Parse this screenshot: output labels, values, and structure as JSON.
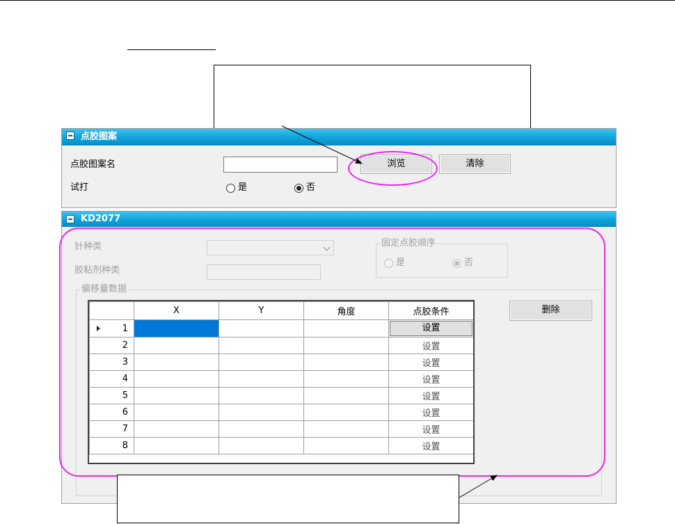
{
  "pattern_panel": {
    "header": "点胶图案",
    "name_label": "点胶图案名",
    "name_value": "",
    "browse_button": "浏览",
    "clear_button": "清除",
    "trial_label": "试打",
    "trial_options": [
      "是",
      "否"
    ],
    "trial_selected": "否"
  },
  "kd_panel": {
    "header": "KD2077",
    "needle_label": "针种类",
    "needle_value": "",
    "adhesive_label": "胶粘剂种类",
    "adhesive_value": "",
    "fixed_order": {
      "title": "固定点胶顺序",
      "options": [
        "是",
        "否"
      ],
      "selected": "否"
    },
    "offset_group_title": "偏移量数据",
    "delete_button": "删除",
    "table": {
      "columns": [
        "",
        "X",
        "Y",
        "角度",
        "点胶条件"
      ],
      "rows": [
        {
          "num": "1",
          "x": "",
          "y": "",
          "angle": "",
          "cond": "设置"
        },
        {
          "num": "2",
          "x": "",
          "y": "",
          "angle": "",
          "cond": "设置"
        },
        {
          "num": "3",
          "x": "",
          "y": "",
          "angle": "",
          "cond": "设置"
        },
        {
          "num": "4",
          "x": "",
          "y": "",
          "angle": "",
          "cond": "设置"
        },
        {
          "num": "5",
          "x": "",
          "y": "",
          "angle": "",
          "cond": "设置"
        },
        {
          "num": "6",
          "x": "",
          "y": "",
          "angle": "",
          "cond": "设置"
        },
        {
          "num": "7",
          "x": "",
          "y": "",
          "angle": "",
          "cond": "设置"
        },
        {
          "num": "8",
          "x": "",
          "y": "",
          "angle": "",
          "cond": "设置"
        }
      ]
    }
  },
  "colors": {
    "header_blue": "#12a6dd",
    "highlight_magenta": "#ee22ee",
    "selection_blue": "#0078d7"
  }
}
